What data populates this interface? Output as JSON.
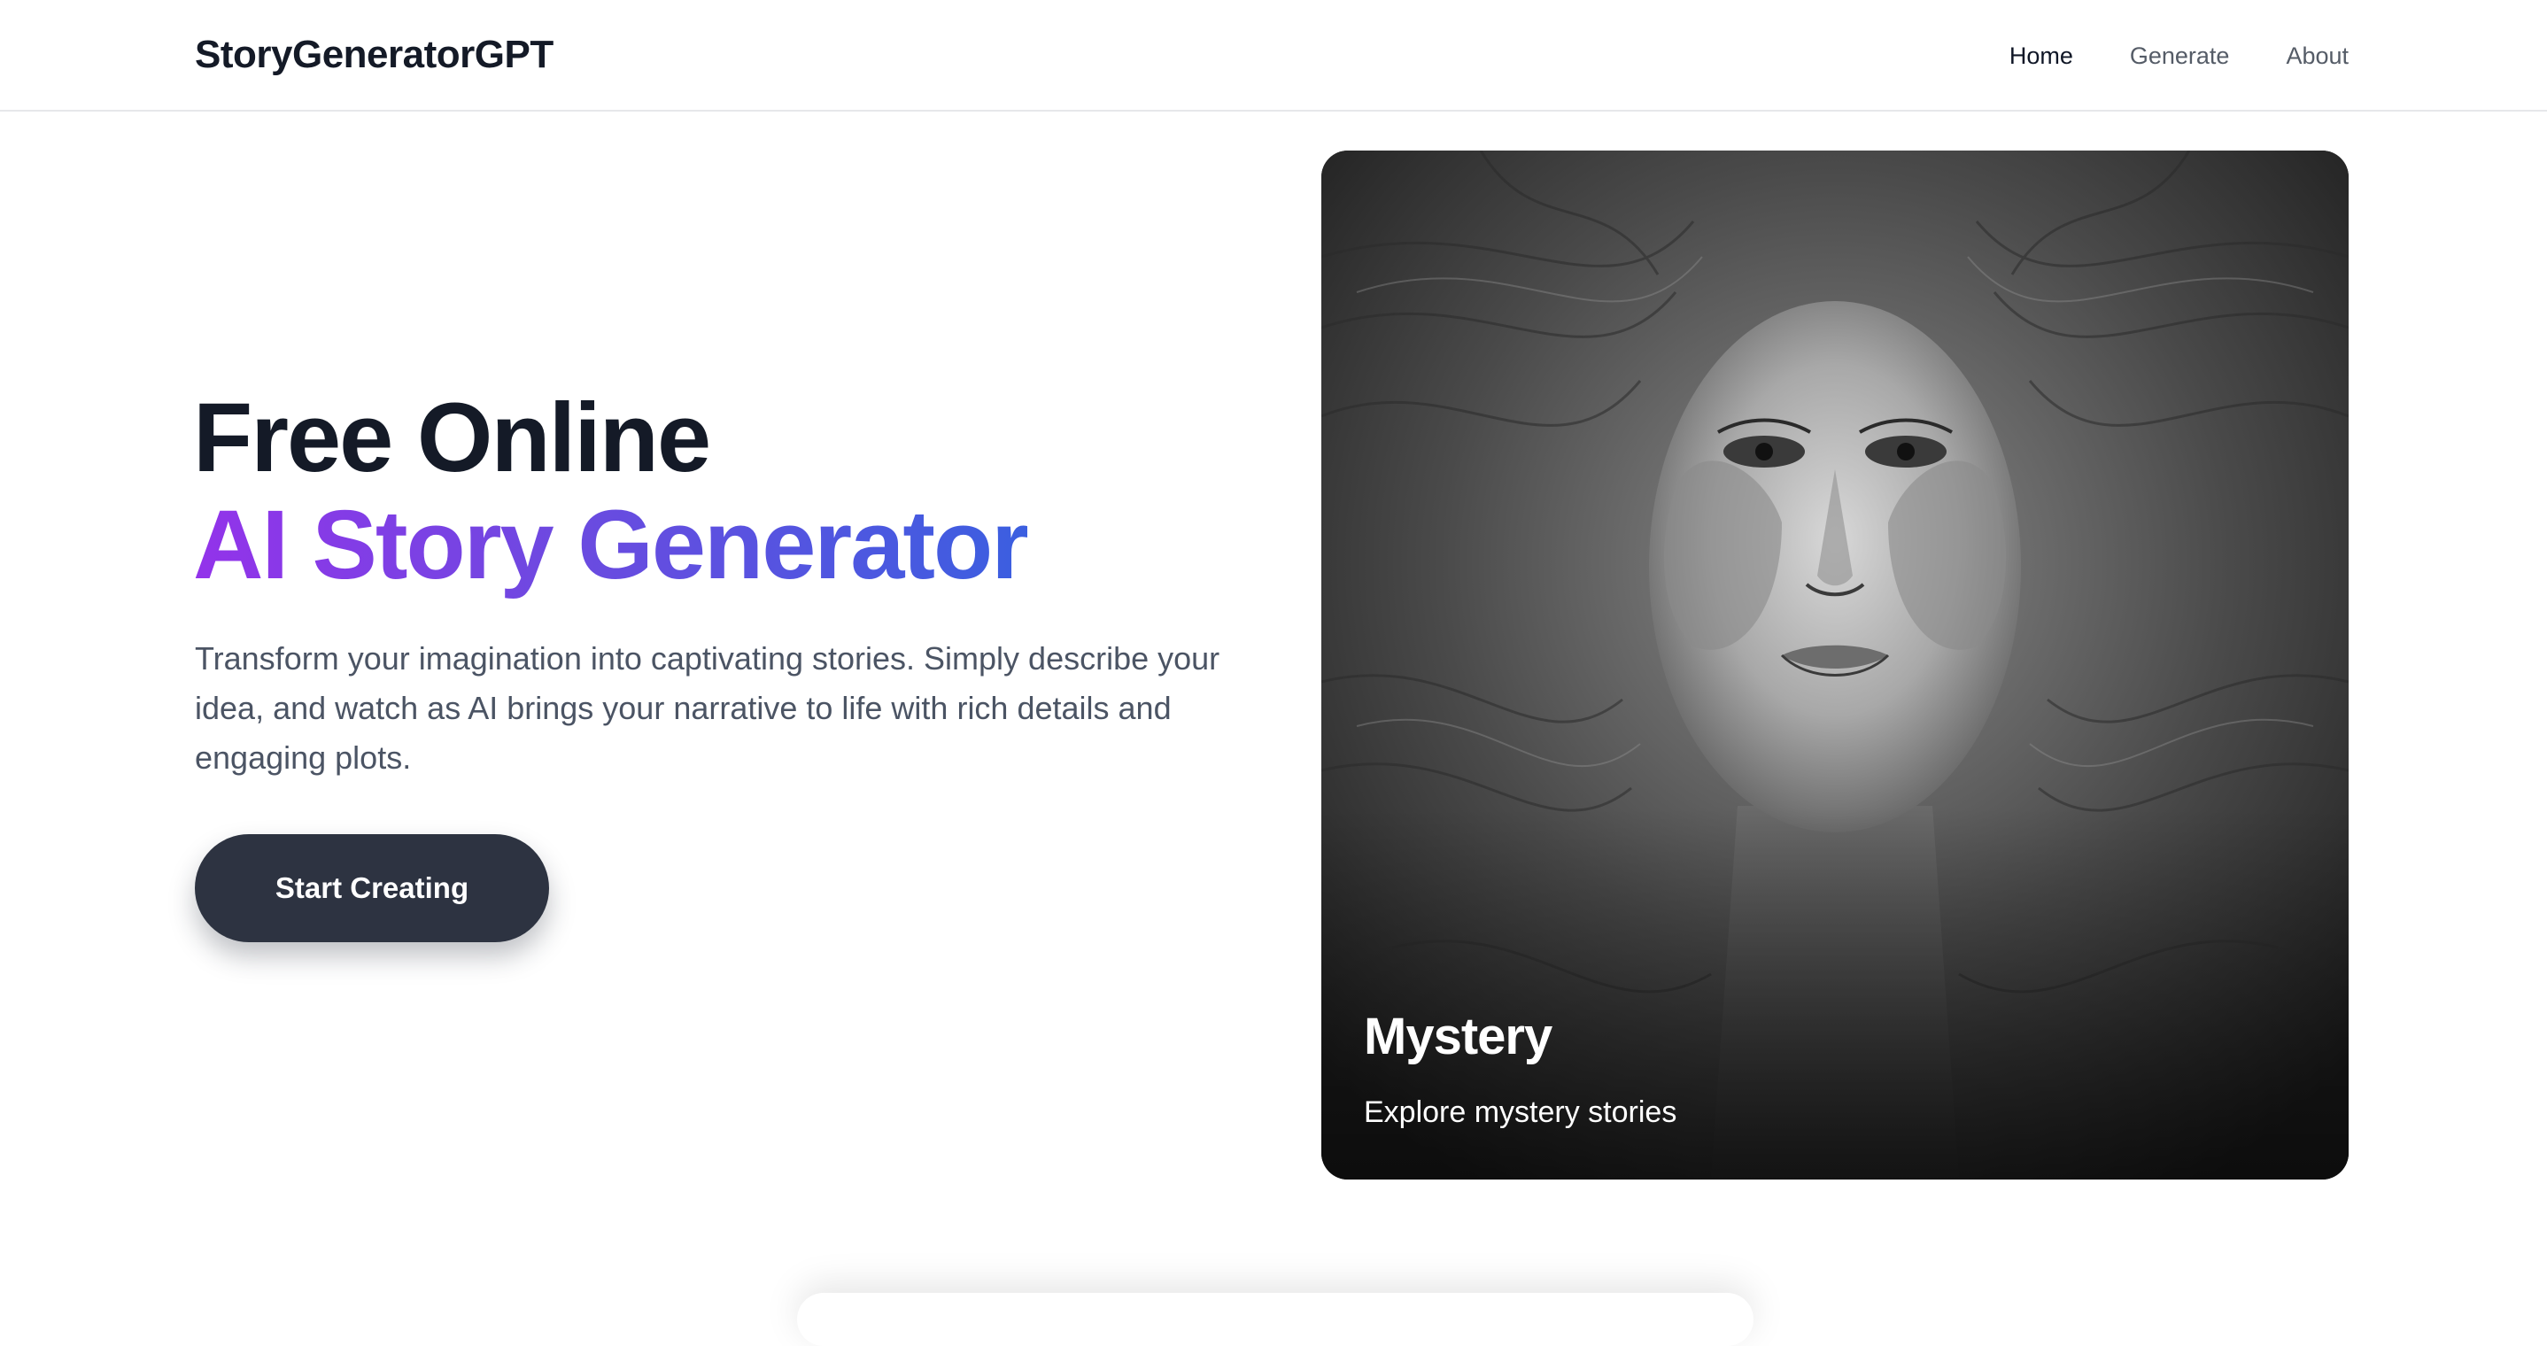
{
  "brand": {
    "name": "StoryGeneratorGPT"
  },
  "nav": {
    "items": [
      {
        "label": "Home",
        "active": true
      },
      {
        "label": "Generate",
        "active": false
      },
      {
        "label": "About",
        "active": false
      }
    ]
  },
  "hero": {
    "title_line1": "Free Online",
    "title_line2": "AI Story Generator",
    "description": "Transform your imagination into captivating stories. Simply describe your idea, and watch as AI brings your narrative to life with rich details and engaging plots.",
    "cta_label": "Start Creating"
  },
  "carousel": {
    "slide_title": "Mystery",
    "slide_subtitle": "Explore mystery stories",
    "slide_count": 5,
    "active_index": 1
  },
  "colors": {
    "text_dark": "#141a27",
    "gradient_start": "#9333ea",
    "gradient_end": "#3b5fe0",
    "cta_bg": "#2d3341"
  },
  "icons": {
    "carousel_image": "monochrome-face-artwork"
  }
}
